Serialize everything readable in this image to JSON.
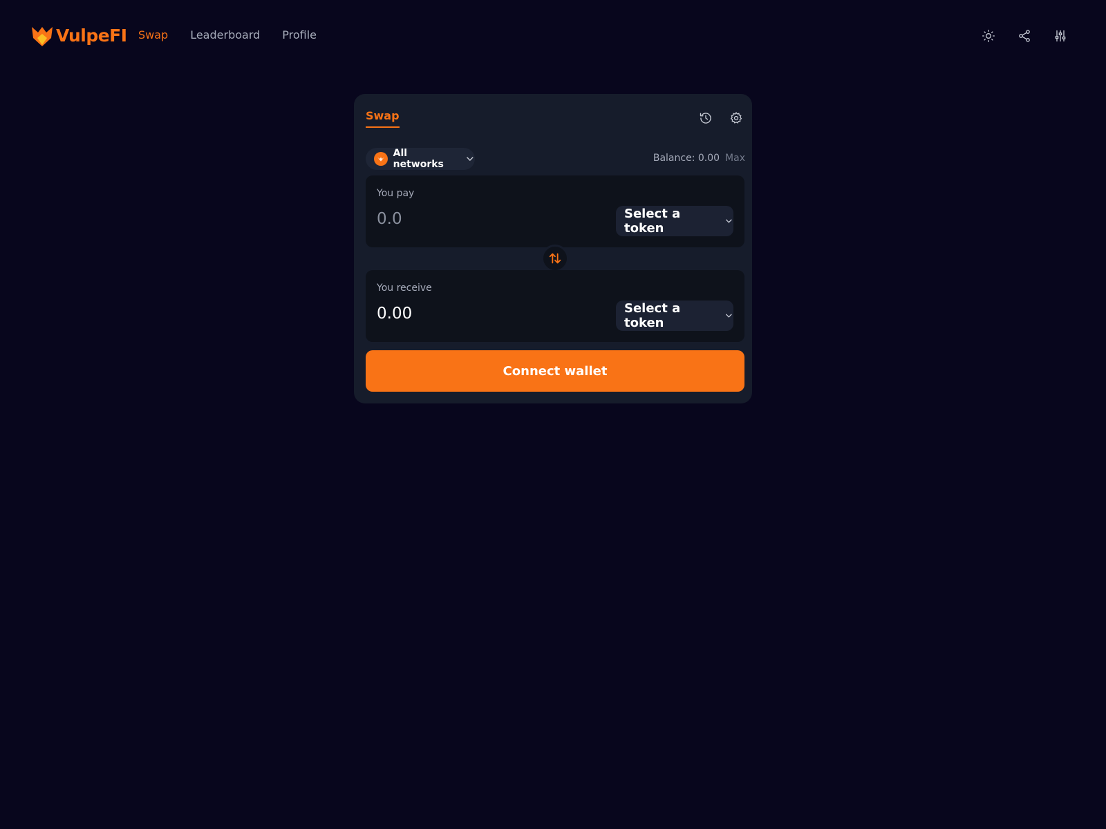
{
  "brand": {
    "name": "VulpeFI",
    "color": "#f97316"
  },
  "nav": {
    "items": [
      {
        "label": "Swap",
        "active": true
      },
      {
        "label": "Leaderboard",
        "active": false
      },
      {
        "label": "Profile",
        "active": false
      }
    ]
  },
  "header_actions": [
    "sun-icon",
    "share-icon",
    "sliders-icon"
  ],
  "swap_card": {
    "tab": "Swap",
    "icons": [
      "history-icon",
      "settings-gear-icon"
    ],
    "network": {
      "label": "All networks",
      "icon": "fox-logo-icon"
    },
    "balance": {
      "text": "Balance: 0.00",
      "max": "Max"
    },
    "pay": {
      "label": "You pay",
      "placeholder": "0.0",
      "token_label": "Select a token"
    },
    "receive": {
      "label": "You receive",
      "value": "0.00",
      "token_label": "Select a token"
    },
    "swap_toggle_icon": "swap-arrows-icon",
    "connect_label": "Connect wallet"
  }
}
